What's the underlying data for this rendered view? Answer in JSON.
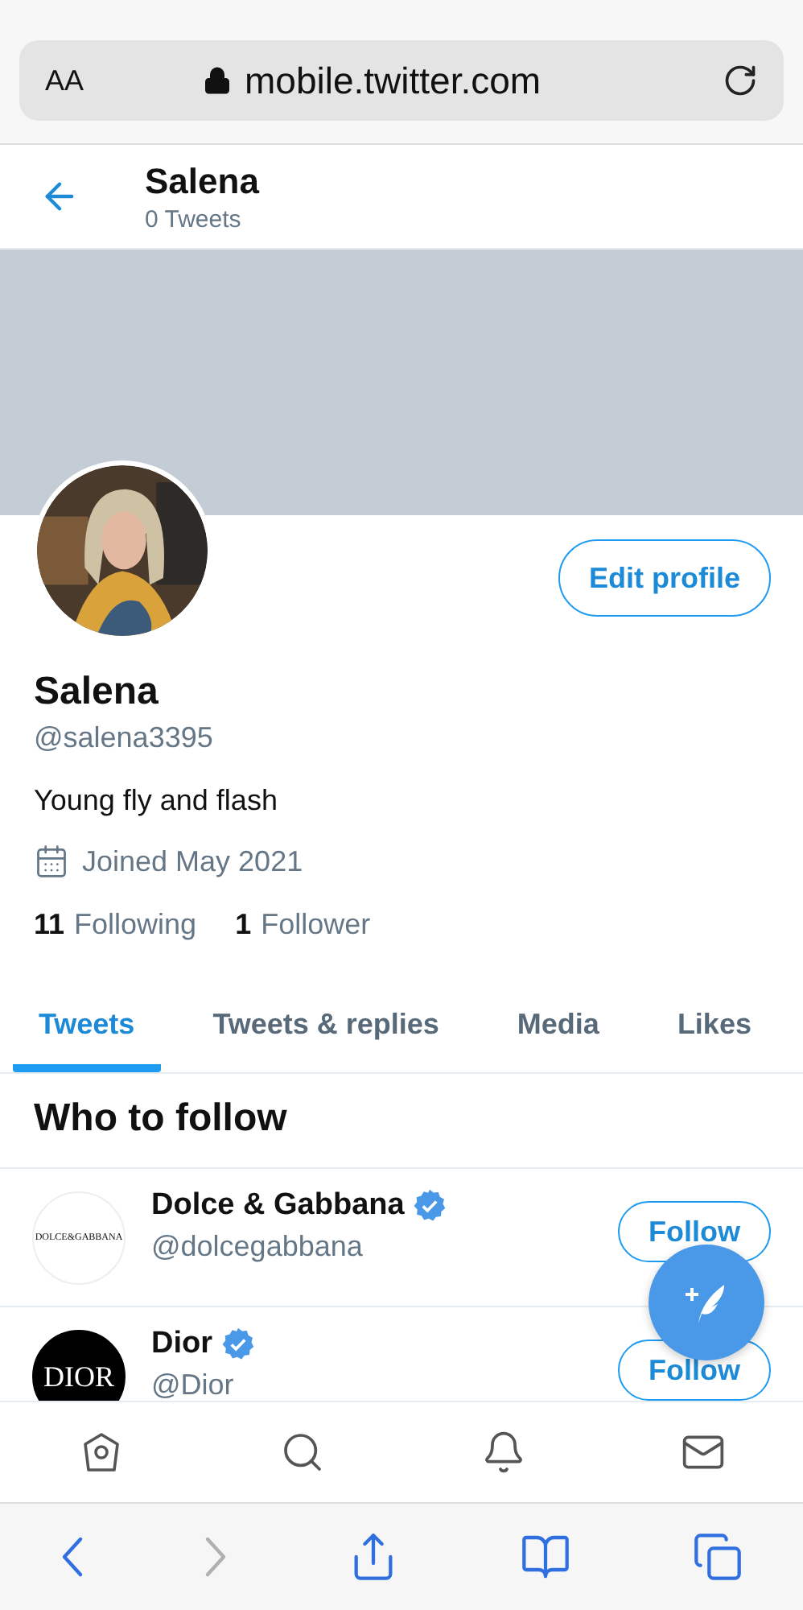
{
  "browser": {
    "text_size": "AA",
    "url": "mobile.twitter.com"
  },
  "header": {
    "name": "Salena",
    "subtitle": "0 Tweets"
  },
  "profile": {
    "edit_button": "Edit profile",
    "name": "Salena",
    "handle": "@salena3395",
    "bio": "Young fly and flash",
    "joined": "Joined May 2021",
    "stats": [
      {
        "count": "11",
        "label": "Following"
      },
      {
        "count": "1",
        "label": "Follower"
      }
    ]
  },
  "tabs": [
    {
      "label": "Tweets",
      "selected": true
    },
    {
      "label": "Tweets & replies",
      "selected": false
    },
    {
      "label": "Media",
      "selected": false
    },
    {
      "label": "Likes",
      "selected": false
    }
  ],
  "who_to_follow": {
    "title": "Who to follow",
    "accounts": [
      {
        "kind": "light",
        "logo": "DOLCE&GABBANA",
        "name": "Dolce & Gabbana",
        "verified": true,
        "handle": "@dolcegabbana",
        "button": "Follow"
      },
      {
        "kind": "dark",
        "logo": "DIOR",
        "name": "Dior",
        "verified": true,
        "handle": "@Dior",
        "button": "Follow"
      }
    ]
  },
  "bottom_nav": [
    {
      "kind": "home"
    },
    {
      "kind": "search"
    },
    {
      "kind": "notifications"
    },
    {
      "kind": "messages"
    }
  ],
  "browser_toolbar": [
    {
      "kind": "back",
      "disabled": false
    },
    {
      "kind": "forward",
      "disabled": true
    },
    {
      "kind": "share",
      "disabled": false
    },
    {
      "kind": "bookmarks",
      "disabled": false
    },
    {
      "kind": "tabs",
      "disabled": false
    }
  ]
}
